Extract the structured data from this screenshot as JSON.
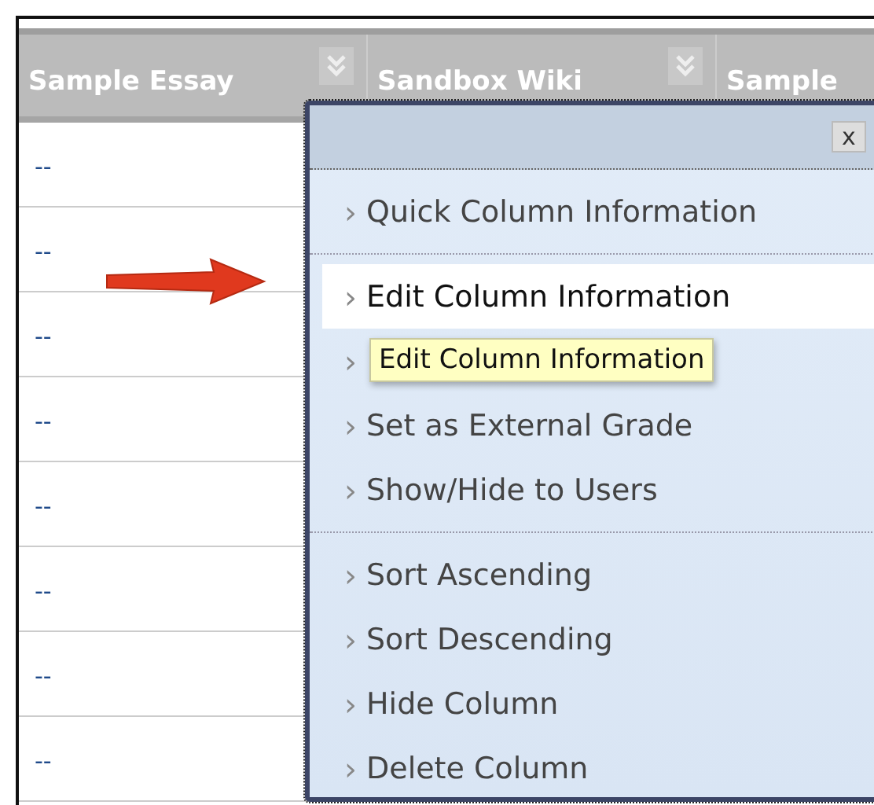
{
  "columns": [
    {
      "title": "Sample Essay",
      "menu_button": true
    },
    {
      "title": "Sandbox Wiki",
      "menu_button": true
    },
    {
      "title": "Sample "
    }
  ],
  "rows": [
    [
      "--"
    ],
    [
      "--"
    ],
    [
      "--"
    ],
    [
      "--"
    ],
    [
      "--"
    ],
    [
      "--"
    ],
    [
      "--"
    ],
    [
      "--"
    ]
  ],
  "menu": {
    "close": "x",
    "groups": [
      [
        {
          "label": "Quick Column Information",
          "selected": false
        }
      ],
      [
        {
          "label": "Edit Column Information",
          "selected": true
        },
        {
          "chevron": "›"
        },
        {
          "label": "Set as External Grade",
          "selected": false
        },
        {
          "label": "Show/Hide to Users",
          "selected": false
        }
      ],
      [
        {
          "label": "Sort Ascending",
          "selected": false
        },
        {
          "label": "Sort Descending",
          "selected": false
        },
        {
          "label": "Hide Column",
          "selected": false
        },
        {
          "label": "Delete Column",
          "selected": false
        }
      ]
    ]
  },
  "tooltip": "Edit Column Information",
  "chevron": "›"
}
